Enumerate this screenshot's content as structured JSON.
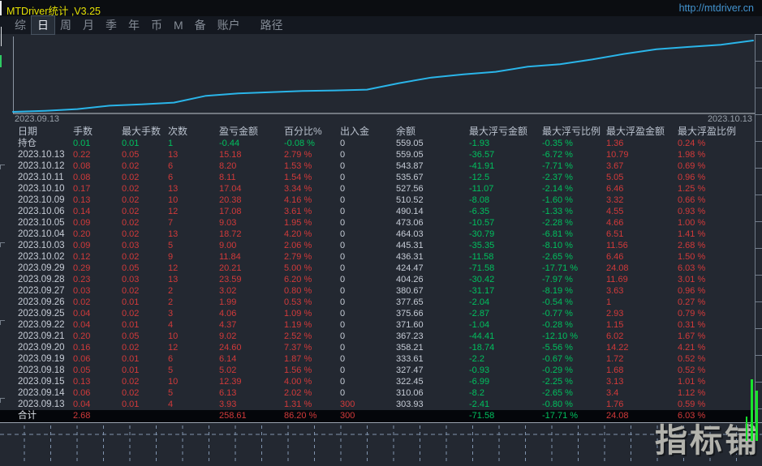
{
  "title_bar": {
    "title": "MTDriver统计 ,V3.25",
    "url": "http://mtdriver.cn"
  },
  "menu": {
    "items": [
      "综",
      "日",
      "周",
      "月",
      "季",
      "年",
      "币",
      "M",
      "备",
      "账户"
    ],
    "active_index": 1,
    "path_label": "路径"
  },
  "chart": {
    "start_date_label": "2023.09.13",
    "end_date_label": "2023.10.13"
  },
  "chart_data": {
    "type": "line",
    "series_name": "余额",
    "x": [
      "2023.09.13",
      "2023.09.14",
      "2023.09.15",
      "2023.09.18",
      "2023.09.19",
      "2023.09.20",
      "2023.09.21",
      "2023.09.22",
      "2023.09.25",
      "2023.09.26",
      "2023.09.27",
      "2023.09.28",
      "2023.09.29",
      "2023.10.02",
      "2023.10.03",
      "2023.10.04",
      "2023.10.05",
      "2023.10.06",
      "2023.10.09",
      "2023.10.10",
      "2023.10.11",
      "2023.10.12",
      "2023.10.13"
    ],
    "start_value": 300,
    "values": [
      303.93,
      310.06,
      322.45,
      327.47,
      333.61,
      358.21,
      367.23,
      371.6,
      375.66,
      377.65,
      380.67,
      404.26,
      424.47,
      436.31,
      445.31,
      464.03,
      473.06,
      490.14,
      510.52,
      527.56,
      535.67,
      543.87,
      559.05
    ],
    "x_range_labels": [
      "2023.09.13",
      "2023.10.13"
    ],
    "line_color": "#2ab5e9",
    "grid": false,
    "legend": "none"
  },
  "table": {
    "headers": [
      "日期",
      "手数",
      "最大手数",
      "次数",
      "盈亏金额",
      "百分比%",
      "出入金",
      "余额",
      "最大浮亏金额",
      "最大浮亏比例",
      "最大浮盈金额",
      "最大浮盈比例"
    ],
    "position_row": [
      "持仓",
      "0.01",
      "0.01",
      "1",
      "-0.44",
      "-0.08 %",
      "0",
      "559.05",
      "-1.93",
      "-0.35 %",
      "1.36",
      "0.24 %"
    ],
    "rows": [
      [
        "2023.10.13",
        "0.22",
        "0.05",
        "13",
        "15.18",
        "2.79 %",
        "0",
        "559.05",
        "-36.57",
        "-6.72 %",
        "10.79",
        "1.98 %"
      ],
      [
        "2023.10.12",
        "0.08",
        "0.02",
        "6",
        "8.20",
        "1.53 %",
        "0",
        "543.87",
        "-41.91",
        "-7.71 %",
        "3.67",
        "0.69 %"
      ],
      [
        "2023.10.11",
        "0.08",
        "0.02",
        "6",
        "8.11",
        "1.54 %",
        "0",
        "535.67",
        "-12.5",
        "-2.37 %",
        "5.05",
        "0.96 %"
      ],
      [
        "2023.10.10",
        "0.17",
        "0.02",
        "13",
        "17.04",
        "3.34 %",
        "0",
        "527.56",
        "-11.07",
        "-2.14 %",
        "6.46",
        "1.25 %"
      ],
      [
        "2023.10.09",
        "0.13",
        "0.02",
        "10",
        "20.38",
        "4.16 %",
        "0",
        "510.52",
        "-8.08",
        "-1.60 %",
        "3.32",
        "0.66 %"
      ],
      [
        "2023.10.06",
        "0.14",
        "0.02",
        "12",
        "17.08",
        "3.61 %",
        "0",
        "490.14",
        "-6.35",
        "-1.33 %",
        "4.55",
        "0.93 %"
      ],
      [
        "2023.10.05",
        "0.09",
        "0.02",
        "7",
        "9.03",
        "1.95 %",
        "0",
        "473.06",
        "-10.57",
        "-2.28 %",
        "4.66",
        "1.00 %"
      ],
      [
        "2023.10.04",
        "0.20",
        "0.02",
        "13",
        "18.72",
        "4.20 %",
        "0",
        "464.03",
        "-30.79",
        "-6.81 %",
        "6.51",
        "1.41 %"
      ],
      [
        "2023.10.03",
        "0.09",
        "0.03",
        "5",
        "9.00",
        "2.06 %",
        "0",
        "445.31",
        "-35.35",
        "-8.10 %",
        "11.56",
        "2.68 %"
      ],
      [
        "2023.10.02",
        "0.12",
        "0.02",
        "9",
        "11.84",
        "2.79 %",
        "0",
        "436.31",
        "-11.58",
        "-2.65 %",
        "6.46",
        "1.50 %"
      ],
      [
        "2023.09.29",
        "0.29",
        "0.05",
        "12",
        "20.21",
        "5.00 %",
        "0",
        "424.47",
        "-71.58",
        "-17.71 %",
        "24.08",
        "6.03 %"
      ],
      [
        "2023.09.28",
        "0.23",
        "0.03",
        "13",
        "23.59",
        "6.20 %",
        "0",
        "404.26",
        "-30.42",
        "-7.97 %",
        "11.69",
        "3.01 %"
      ],
      [
        "2023.09.27",
        "0.03",
        "0.02",
        "2",
        "3.02",
        "0.80 %",
        "0",
        "380.67",
        "-31.17",
        "-8.19 %",
        "3.63",
        "0.96 %"
      ],
      [
        "2023.09.26",
        "0.02",
        "0.01",
        "2",
        "1.99",
        "0.53 %",
        "0",
        "377.65",
        "-2.04",
        "-0.54 %",
        "1",
        "0.27 %"
      ],
      [
        "2023.09.25",
        "0.04",
        "0.02",
        "3",
        "4.06",
        "1.09 %",
        "0",
        "375.66",
        "-2.87",
        "-0.77 %",
        "2.93",
        "0.79 %"
      ],
      [
        "2023.09.22",
        "0.04",
        "0.01",
        "4",
        "4.37",
        "1.19 %",
        "0",
        "371.60",
        "-1.04",
        "-0.28 %",
        "1.15",
        "0.31 %"
      ],
      [
        "2023.09.21",
        "0.20",
        "0.05",
        "10",
        "9.02",
        "2.52 %",
        "0",
        "367.23",
        "-44.41",
        "-12.10 %",
        "6.02",
        "1.67 %"
      ],
      [
        "2023.09.20",
        "0.16",
        "0.02",
        "12",
        "24.60",
        "7.37 %",
        "0",
        "358.21",
        "-18.74",
        "-5.56 %",
        "14.22",
        "4.21 %"
      ],
      [
        "2023.09.19",
        "0.06",
        "0.01",
        "6",
        "6.14",
        "1.87 %",
        "0",
        "333.61",
        "-2.2",
        "-0.67 %",
        "1.72",
        "0.52 %"
      ],
      [
        "2023.09.18",
        "0.05",
        "0.01",
        "5",
        "5.02",
        "1.56 %",
        "0",
        "327.47",
        "-0.93",
        "-0.29 %",
        "1.68",
        "0.52 %"
      ],
      [
        "2023.09.15",
        "0.13",
        "0.02",
        "10",
        "12.39",
        "4.00 %",
        "0",
        "322.45",
        "-6.99",
        "-2.25 %",
        "3.13",
        "1.01 %"
      ],
      [
        "2023.09.14",
        "0.06",
        "0.02",
        "5",
        "6.13",
        "2.02 %",
        "0",
        "310.06",
        "-8.2",
        "-2.65 %",
        "3.4",
        "1.12 %"
      ],
      [
        "2023.09.13",
        "0.04",
        "0.01",
        "4",
        "3.93",
        "1.31 %",
        "300",
        "303.93",
        "-2.41",
        "-0.80 %",
        "1.76",
        "0.59 %"
      ]
    ],
    "summary": [
      "合计",
      "2.68",
      "",
      "",
      "258.61",
      "86.20 %",
      "300",
      "",
      "-71.58",
      "-17.71 %",
      "24.08",
      "6.03 %"
    ]
  },
  "watermark": "指标铺",
  "colors": {
    "gain_red": "#d23a3a",
    "loss_green": "#00c05e",
    "neutral_text": "#c6ccd6",
    "title_yellow": "#e4e104",
    "url_blue": "#4394d0",
    "equity_line": "#2ab5e9"
  }
}
